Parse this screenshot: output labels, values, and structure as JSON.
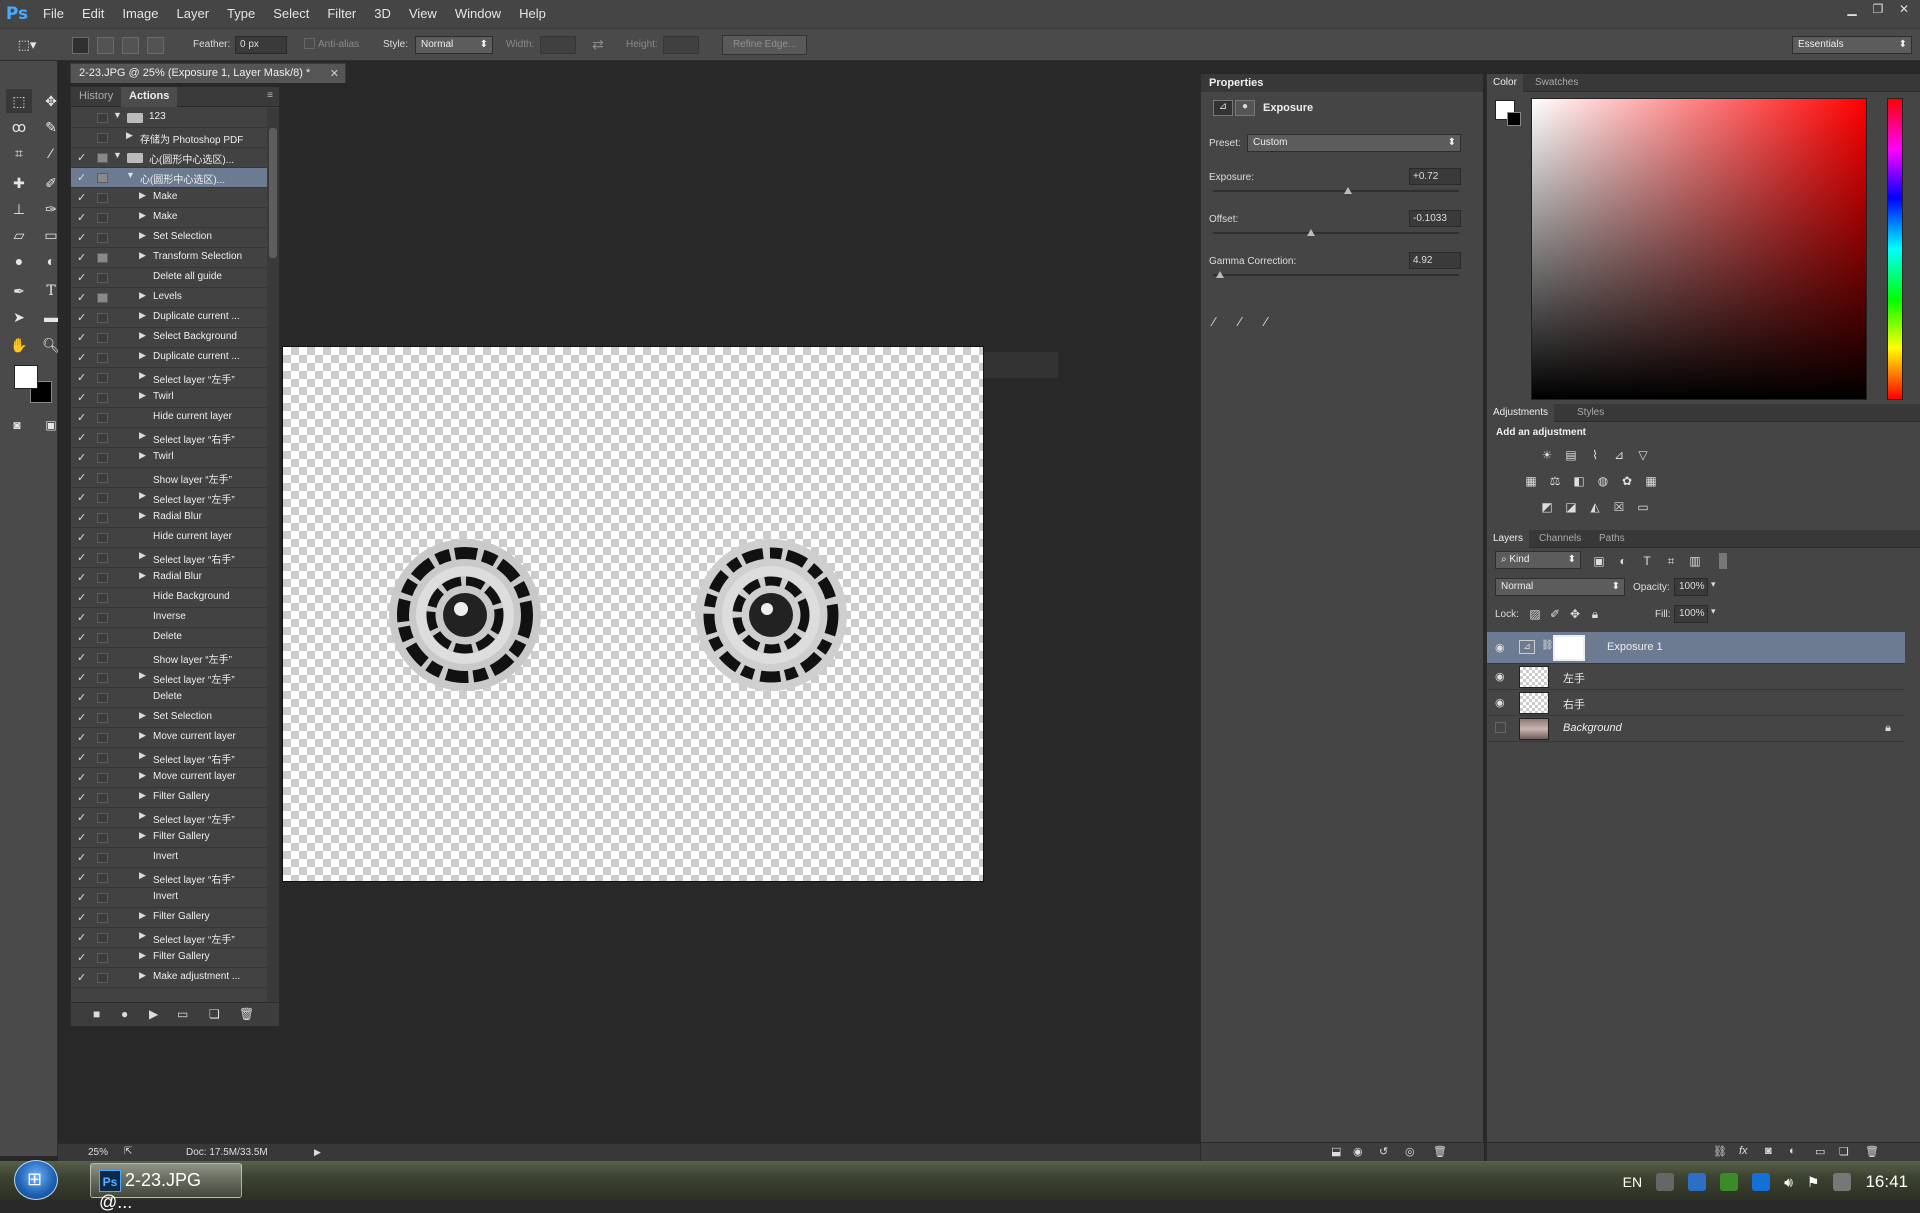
{
  "app": {
    "logo": "Ps"
  },
  "menu": [
    "File",
    "Edit",
    "Image",
    "Layer",
    "Type",
    "Select",
    "Filter",
    "3D",
    "View",
    "Window",
    "Help"
  ],
  "options": {
    "feather_label": "Feather:",
    "feather_value": "0 px",
    "antialias_label": "Anti-alias",
    "style_label": "Style:",
    "style_value": "Normal",
    "width_label": "Width:",
    "height_label": "Height:",
    "refine_label": "Refine Edge...",
    "workspace": "Essentials"
  },
  "document": {
    "tab_title": "2-23.JPG @ 25% (Exposure 1, Layer Mask/8) *",
    "zoom": "25%",
    "doc_size": "Doc: 17.5M/33.5M"
  },
  "actions_panel": {
    "tab_history": "History",
    "tab_actions": "Actions",
    "rows": [
      {
        "check": "",
        "dialog": false,
        "indent": 0,
        "type": "folder",
        "expanded": true,
        "label": "123"
      },
      {
        "check": "",
        "dialog": false,
        "indent": 1,
        "type": "action",
        "expanded": false,
        "label": "存储为 Photoshop PDF"
      },
      {
        "check": "✓",
        "dialog": true,
        "indent": 0,
        "type": "folder",
        "expanded": true,
        "label": "心(圆形中心选区)..."
      },
      {
        "check": "✓",
        "dialog": true,
        "indent": 1,
        "type": "action",
        "expanded": true,
        "label": "心(圆形中心选区)...",
        "selected": true
      },
      {
        "check": "✓",
        "dialog": false,
        "indent": 2,
        "type": "step",
        "expanded": false,
        "label": "Make"
      },
      {
        "check": "✓",
        "dialog": false,
        "indent": 2,
        "type": "step",
        "expanded": false,
        "label": "Make"
      },
      {
        "check": "✓",
        "dialog": false,
        "indent": 2,
        "type": "step",
        "expanded": false,
        "label": "Set Selection"
      },
      {
        "check": "✓",
        "dialog": true,
        "indent": 2,
        "type": "step",
        "expanded": false,
        "label": "Transform Selection"
      },
      {
        "check": "✓",
        "dialog": false,
        "indent": 2,
        "type": "plain",
        "expanded": false,
        "label": "Delete all guide"
      },
      {
        "check": "✓",
        "dialog": true,
        "indent": 2,
        "type": "step",
        "expanded": false,
        "label": "Levels"
      },
      {
        "check": "✓",
        "dialog": false,
        "indent": 2,
        "type": "step",
        "expanded": false,
        "label": "Duplicate current ..."
      },
      {
        "check": "✓",
        "dialog": false,
        "indent": 2,
        "type": "step",
        "expanded": false,
        "label": "Select Background"
      },
      {
        "check": "✓",
        "dialog": false,
        "indent": 2,
        "type": "step",
        "expanded": false,
        "label": "Duplicate current ..."
      },
      {
        "check": "✓",
        "dialog": false,
        "indent": 2,
        "type": "step",
        "expanded": false,
        "label": "Select layer “左手”"
      },
      {
        "check": "✓",
        "dialog": false,
        "indent": 2,
        "type": "step",
        "expanded": false,
        "label": "Twirl"
      },
      {
        "check": "✓",
        "dialog": false,
        "indent": 2,
        "type": "plain",
        "expanded": false,
        "label": "Hide current layer"
      },
      {
        "check": "✓",
        "dialog": false,
        "indent": 2,
        "type": "step",
        "expanded": false,
        "label": "Select layer “右手”"
      },
      {
        "check": "✓",
        "dialog": false,
        "indent": 2,
        "type": "step",
        "expanded": false,
        "label": "Twirl"
      },
      {
        "check": "✓",
        "dialog": false,
        "indent": 2,
        "type": "plain",
        "expanded": false,
        "label": "Show layer “左手”"
      },
      {
        "check": "✓",
        "dialog": false,
        "indent": 2,
        "type": "step",
        "expanded": false,
        "label": "Select layer “左手”"
      },
      {
        "check": "✓",
        "dialog": false,
        "indent": 2,
        "type": "step",
        "expanded": false,
        "label": "Radial Blur"
      },
      {
        "check": "✓",
        "dialog": false,
        "indent": 2,
        "type": "plain",
        "expanded": false,
        "label": "Hide current layer"
      },
      {
        "check": "✓",
        "dialog": false,
        "indent": 2,
        "type": "step",
        "expanded": false,
        "label": "Select layer “右手”"
      },
      {
        "check": "✓",
        "dialog": false,
        "indent": 2,
        "type": "step",
        "expanded": false,
        "label": "Radial Blur"
      },
      {
        "check": "✓",
        "dialog": false,
        "indent": 2,
        "type": "plain",
        "expanded": false,
        "label": "Hide Background"
      },
      {
        "check": "✓",
        "dialog": false,
        "indent": 2,
        "type": "plain",
        "expanded": false,
        "label": "Inverse"
      },
      {
        "check": "✓",
        "dialog": false,
        "indent": 2,
        "type": "plain",
        "expanded": false,
        "label": "Delete"
      },
      {
        "check": "✓",
        "dialog": false,
        "indent": 2,
        "type": "plain",
        "expanded": false,
        "label": "Show layer “左手”"
      },
      {
        "check": "✓",
        "dialog": false,
        "indent": 2,
        "type": "step",
        "expanded": false,
        "label": "Select layer “左手”"
      },
      {
        "check": "✓",
        "dialog": false,
        "indent": 2,
        "type": "plain",
        "expanded": false,
        "label": "Delete"
      },
      {
        "check": "✓",
        "dialog": false,
        "indent": 2,
        "type": "step",
        "expanded": false,
        "label": "Set Selection"
      },
      {
        "check": "✓",
        "dialog": false,
        "indent": 2,
        "type": "step",
        "expanded": false,
        "label": "Move current layer"
      },
      {
        "check": "✓",
        "dialog": false,
        "indent": 2,
        "type": "step",
        "expanded": false,
        "label": "Select layer “右手”"
      },
      {
        "check": "✓",
        "dialog": false,
        "indent": 2,
        "type": "step",
        "expanded": false,
        "label": "Move current layer"
      },
      {
        "check": "✓",
        "dialog": false,
        "indent": 2,
        "type": "step",
        "expanded": false,
        "label": "Filter Gallery"
      },
      {
        "check": "✓",
        "dialog": false,
        "indent": 2,
        "type": "step",
        "expanded": false,
        "label": "Select layer “左手”"
      },
      {
        "check": "✓",
        "dialog": false,
        "indent": 2,
        "type": "step",
        "expanded": false,
        "label": "Filter Gallery"
      },
      {
        "check": "✓",
        "dialog": false,
        "indent": 2,
        "type": "plain",
        "expanded": false,
        "label": "Invert"
      },
      {
        "check": "✓",
        "dialog": false,
        "indent": 2,
        "type": "step",
        "expanded": false,
        "label": "Select layer “右手”"
      },
      {
        "check": "✓",
        "dialog": false,
        "indent": 2,
        "type": "plain",
        "expanded": false,
        "label": "Invert"
      },
      {
        "check": "✓",
        "dialog": false,
        "indent": 2,
        "type": "step",
        "expanded": false,
        "label": "Filter Gallery"
      },
      {
        "check": "✓",
        "dialog": false,
        "indent": 2,
        "type": "step",
        "expanded": false,
        "label": "Select layer “左手”"
      },
      {
        "check": "✓",
        "dialog": false,
        "indent": 2,
        "type": "step",
        "expanded": false,
        "label": "Filter Gallery"
      },
      {
        "check": "✓",
        "dialog": false,
        "indent": 2,
        "type": "step",
        "expanded": false,
        "label": "Make adjustment ..."
      }
    ]
  },
  "properties": {
    "tab": "Properties",
    "title": "Exposure",
    "preset_label": "Preset:",
    "preset_value": "Custom",
    "exposure_label": "Exposure:",
    "exposure_value": "+0.72",
    "exposure_level": 0.55,
    "offset_label": "Offset:",
    "offset_value": "-0.1033",
    "offset_level": 0.4,
    "gamma_label": "Gamma Correction:",
    "gamma_value": "4.92",
    "gamma_level": 0.03
  },
  "color_panel": {
    "tab_color": "Color",
    "tab_swatches": "Swatches",
    "hue_color": "#ff0000"
  },
  "adjustments": {
    "tab_adjustments": "Adjustments",
    "tab_styles": "Styles",
    "heading": "Add an adjustment"
  },
  "layers_panel": {
    "tab_layers": "Layers",
    "tab_channels": "Channels",
    "tab_paths": "Paths",
    "kind": "Kind",
    "blend": "Normal",
    "opacity_label": "Opacity:",
    "opacity": "100%",
    "lock_label": "Lock:",
    "fill_label": "Fill:",
    "fill": "100%",
    "layers": [
      {
        "name": "Exposure 1",
        "visible": true,
        "selected": true,
        "type": "adjustment"
      },
      {
        "name": "左手",
        "visible": true,
        "selected": false,
        "type": "pixel"
      },
      {
        "name": "右手",
        "visible": true,
        "selected": false,
        "type": "pixel"
      },
      {
        "name": "Background",
        "visible": false,
        "selected": false,
        "type": "background",
        "locked": true
      }
    ]
  },
  "taskbar": {
    "app_label": "2-23.JPG @...",
    "lang": "EN",
    "time": "16:41"
  }
}
